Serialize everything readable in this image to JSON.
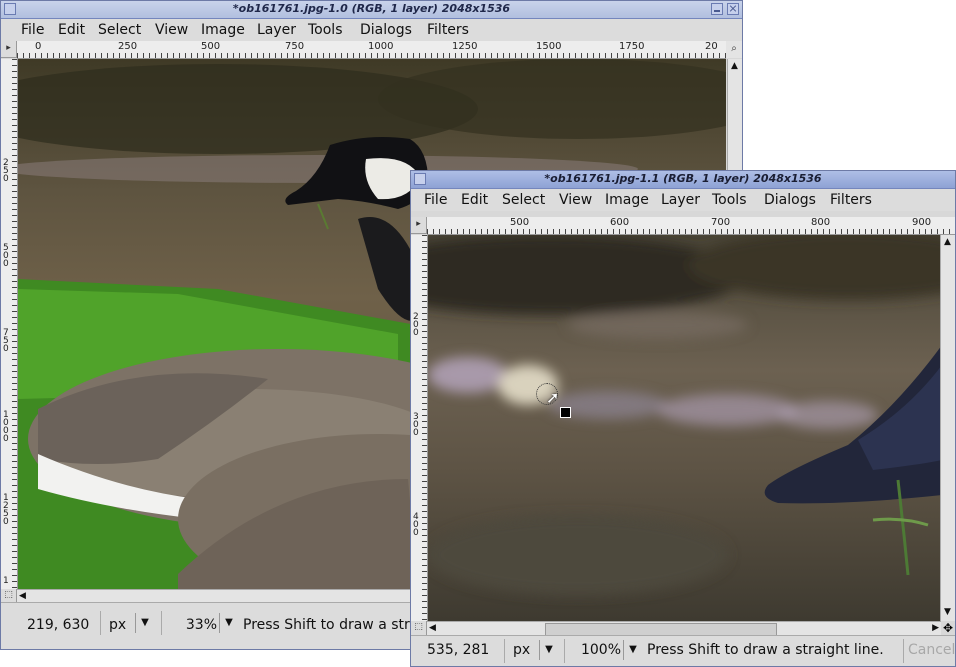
{
  "window1": {
    "title": "*ob161761.jpg-1.0 (RGB, 1 layer) 2048x1536",
    "menu": [
      "File",
      "Edit",
      "Select",
      "View",
      "Image",
      "Layer",
      "Tools",
      "Dialogs",
      "Filters"
    ],
    "hruler": [
      "0",
      "250",
      "500",
      "750",
      "1000",
      "1250",
      "1500",
      "1750",
      "20"
    ],
    "vruler": [
      "250",
      "500",
      "750",
      "1000",
      "1250",
      "1"
    ],
    "status": {
      "coords": "219, 630",
      "unit": "px",
      "zoom": "33%",
      "message": "Press Shift to draw a stra"
    }
  },
  "window2": {
    "title": "*ob161761.jpg-1.1 (RGB, 1 layer) 2048x1536",
    "menu": [
      "File",
      "Edit",
      "Select",
      "View",
      "Image",
      "Layer",
      "Tools",
      "Dialogs",
      "Filters"
    ],
    "hruler": [
      "500",
      "600",
      "700",
      "800",
      "900"
    ],
    "vruler": [
      "200",
      "300",
      "400"
    ],
    "status": {
      "coords": "535, 281",
      "unit": "px",
      "zoom": "100%",
      "message": "Press Shift to draw a straight line.",
      "cancel": "Cancel"
    }
  },
  "icons": {
    "quick_mask": "quick-mask-icon",
    "zoom": "zoom-magnifier-icon",
    "navigate": "navigate-cross-icon",
    "cursor": "pointer-cursor-icon"
  },
  "colors": {
    "title_active": "#8ea2d4",
    "title_inactive": "#b1bfdf",
    "chrome": "#d8d8d8"
  }
}
